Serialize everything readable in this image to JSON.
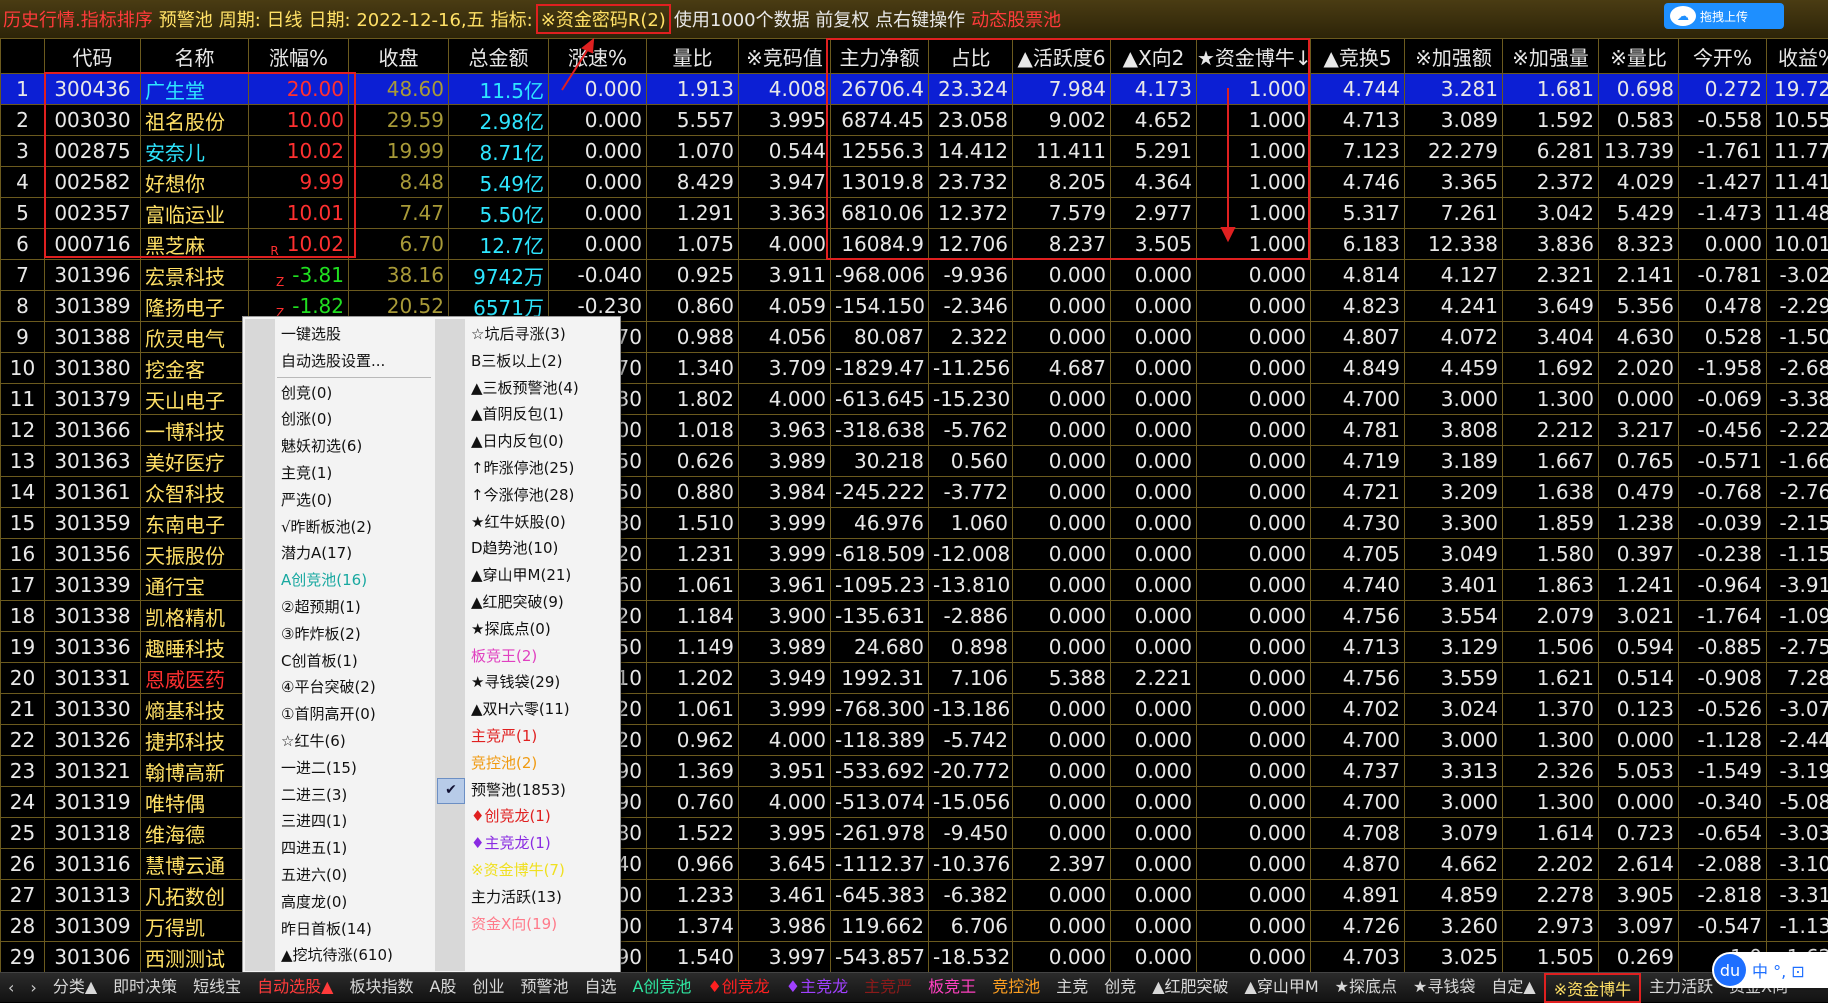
{
  "topbar": {
    "history": "历史行情.指标排序",
    "pool": "预警池",
    "period": "周期: 日线",
    "date": "日期: 2022-12-16,五",
    "indicator_label": "指标:",
    "indicator_value": "※资金密码R(2)",
    "info": "使用1000个数据 前复权 点右键操作",
    "dynamic": "动态股票池",
    "upload": "拖拽上传"
  },
  "columns": [
    "",
    "代码",
    "名称",
    "涨幅%",
    "收盘",
    "总金额",
    "涨速%",
    "量比",
    "※竞码值",
    "主力净额",
    "占比",
    "▲活跃度6",
    "▲X向2",
    "★资金博牛↓",
    "▲竞换5",
    "※加强额",
    "※加强量",
    "※量比",
    "今开%",
    "收益%"
  ],
  "rows": [
    {
      "i": "1",
      "code": "300436",
      "name": "广生堂",
      "chg": "20.00",
      "close": "48.60",
      "amt": "11.5亿",
      "spd": "0.000",
      "vr": "1.913",
      "jm": "4.008",
      "zl": "26706.4",
      "zb": "23.324",
      "hy": "7.984",
      "xx": "4.173",
      "bn": "1.000",
      "jh": "4.744",
      "qe": "3.281",
      "ql": "1.681",
      "lb": "0.698",
      "jk": "0.272",
      "sy": "19.728",
      "flag": ""
    },
    {
      "i": "2",
      "code": "003030",
      "name": "祖名股份",
      "chg": "10.00",
      "close": "29.59",
      "amt": "2.98亿",
      "spd": "0.000",
      "vr": "5.557",
      "jm": "3.995",
      "zl": "6874.45",
      "zb": "23.058",
      "hy": "9.002",
      "xx": "4.652",
      "bn": "1.000",
      "jh": "4.713",
      "qe": "3.089",
      "ql": "1.592",
      "lb": "0.583",
      "jk": "-0.558",
      "sy": "10.558",
      "flag": ""
    },
    {
      "i": "3",
      "code": "002875",
      "name": "安奈儿",
      "chg": "10.02",
      "close": "19.99",
      "amt": "8.71亿",
      "spd": "0.000",
      "vr": "1.070",
      "jm": "0.544",
      "zl": "12556.3",
      "zb": "14.412",
      "hy": "11.411",
      "xx": "5.291",
      "bn": "1.000",
      "jh": "7.123",
      "qe": "22.279",
      "ql": "6.281",
      "lb": "13.739",
      "jk": "-1.761",
      "sy": "11.778",
      "flag": ""
    },
    {
      "i": "4",
      "code": "002582",
      "name": "好想你",
      "chg": "9.99",
      "close": "8.48",
      "amt": "5.49亿",
      "spd": "0.000",
      "vr": "8.429",
      "jm": "3.947",
      "zl": "13019.8",
      "zb": "23.732",
      "hy": "8.205",
      "xx": "4.364",
      "bn": "1.000",
      "jh": "4.746",
      "qe": "3.365",
      "ql": "2.372",
      "lb": "4.029",
      "jk": "-1.427",
      "sy": "11.414",
      "flag": ""
    },
    {
      "i": "5",
      "code": "002357",
      "name": "富临运业",
      "chg": "10.01",
      "close": "7.47",
      "amt": "5.50亿",
      "spd": "0.000",
      "vr": "1.291",
      "jm": "3.363",
      "zl": "6810.06",
      "zb": "12.372",
      "hy": "7.579",
      "xx": "2.977",
      "bn": "1.000",
      "jh": "5.317",
      "qe": "7.261",
      "ql": "3.042",
      "lb": "5.429",
      "jk": "-1.473",
      "sy": "11.487",
      "flag": ""
    },
    {
      "i": "6",
      "code": "000716",
      "name": "黑芝麻",
      "chg": "10.02",
      "close": "6.70",
      "amt": "12.7亿",
      "spd": "0.000",
      "vr": "1.075",
      "jm": "4.000",
      "zl": "16084.9",
      "zb": "12.706",
      "hy": "8.237",
      "xx": "3.505",
      "bn": "1.000",
      "jh": "6.183",
      "qe": "12.338",
      "ql": "3.836",
      "lb": "8.323",
      "jk": "0.000",
      "sy": "10.016",
      "flag": "R"
    },
    {
      "i": "7",
      "code": "301396",
      "name": "宏景科技",
      "chg": "-3.81",
      "close": "38.16",
      "amt": "9742万",
      "spd": "-0.040",
      "vr": "0.925",
      "jm": "3.911",
      "zl": "-968.006",
      "zb": "-9.936",
      "hy": "0.000",
      "xx": "0.000",
      "bn": "0.000",
      "jh": "4.814",
      "qe": "4.127",
      "ql": "2.321",
      "lb": "2.141",
      "jk": "-0.781",
      "sy": "-3.025",
      "flag": "Z"
    },
    {
      "i": "8",
      "code": "301389",
      "name": "隆扬电子",
      "chg": "-1.82",
      "close": "20.52",
      "amt": "6571万",
      "spd": "-0.230",
      "vr": "0.860",
      "jm": "4.059",
      "zl": "-154.150",
      "zb": "-2.346",
      "hy": "0.000",
      "xx": "0.000",
      "bn": "0.000",
      "jh": "4.823",
      "qe": "4.241",
      "ql": "3.649",
      "lb": "5.356",
      "jk": "0.478",
      "sy": "-2.297",
      "flag": "Z"
    },
    {
      "i": "9",
      "code": "301388",
      "name": "欣灵电气",
      "chg": "",
      "close": "",
      "amt": "",
      "spd": "70",
      "vr": "0.988",
      "jm": "4.056",
      "zl": "80.087",
      "zb": "2.322",
      "hy": "0.000",
      "xx": "0.000",
      "bn": "0.000",
      "jh": "4.807",
      "qe": "4.072",
      "ql": "3.404",
      "lb": "4.630",
      "jk": "0.528",
      "sy": "-1.508",
      "flag": ""
    },
    {
      "i": "10",
      "code": "301380",
      "name": "挖金客",
      "chg": "",
      "close": "",
      "amt": "",
      "spd": "70",
      "vr": "1.340",
      "jm": "3.709",
      "zl": "-1829.47",
      "zb": "-11.256",
      "hy": "4.687",
      "xx": "0.000",
      "bn": "0.000",
      "jh": "4.849",
      "qe": "4.459",
      "ql": "1.692",
      "lb": "2.020",
      "jk": "-1.958",
      "sy": "-2.689",
      "flag": ""
    },
    {
      "i": "11",
      "code": "301379",
      "name": "天山电子",
      "chg": "",
      "close": "",
      "amt": "",
      "spd": "30",
      "vr": "1.802",
      "jm": "4.000",
      "zl": "-613.645",
      "zb": "-15.230",
      "hy": "0.000",
      "xx": "0.000",
      "bn": "0.000",
      "jh": "4.700",
      "qe": "3.000",
      "ql": "1.300",
      "lb": "0.000",
      "jk": "-0.069",
      "sy": "-3.389",
      "flag": ""
    },
    {
      "i": "12",
      "code": "301366",
      "name": "一博科技",
      "chg": "",
      "close": "",
      "amt": "",
      "spd": "00",
      "vr": "1.018",
      "jm": "3.963",
      "zl": "-318.638",
      "zb": "-5.762",
      "hy": "0.000",
      "xx": "0.000",
      "bn": "0.000",
      "jh": "4.781",
      "qe": "3.808",
      "ql": "2.212",
      "lb": "3.217",
      "jk": "-0.456",
      "sy": "-2.220",
      "flag": ""
    },
    {
      "i": "13",
      "code": "301363",
      "name": "美好医疗",
      "chg": "",
      "close": "",
      "amt": "",
      "spd": "50",
      "vr": "0.626",
      "jm": "3.989",
      "zl": "30.218",
      "zb": "0.560",
      "hy": "0.000",
      "xx": "0.000",
      "bn": "0.000",
      "jh": "4.719",
      "qe": "3.189",
      "ql": "1.667",
      "lb": "0.765",
      "jk": "-0.571",
      "sy": "-1.661",
      "flag": ""
    },
    {
      "i": "14",
      "code": "301361",
      "name": "众智科技",
      "chg": "",
      "close": "",
      "amt": "",
      "spd": "50",
      "vr": "0.880",
      "jm": "3.984",
      "zl": "-245.222",
      "zb": "-3.772",
      "hy": "0.000",
      "xx": "0.000",
      "bn": "0.000",
      "jh": "4.721",
      "qe": "3.209",
      "ql": "1.638",
      "lb": "0.479",
      "jk": "-0.768",
      "sy": "-2.765",
      "flag": ""
    },
    {
      "i": "15",
      "code": "301359",
      "name": "东南电子",
      "chg": "",
      "close": "",
      "amt": "",
      "spd": "80",
      "vr": "1.510",
      "jm": "3.999",
      "zl": "46.976",
      "zb": "1.060",
      "hy": "0.000",
      "xx": "0.000",
      "bn": "0.000",
      "jh": "4.730",
      "qe": "3.300",
      "ql": "1.859",
      "lb": "1.238",
      "jk": "-0.039",
      "sy": "-2.159",
      "flag": ""
    },
    {
      "i": "16",
      "code": "301356",
      "name": "天振股份",
      "chg": "",
      "close": "",
      "amt": "",
      "spd": "20",
      "vr": "1.231",
      "jm": "3.999",
      "zl": "-618.509",
      "zb": "-12.008",
      "hy": "0.000",
      "xx": "0.000",
      "bn": "0.000",
      "jh": "4.705",
      "qe": "3.049",
      "ql": "1.580",
      "lb": "0.397",
      "jk": "-0.238",
      "sy": "-1.151",
      "flag": ""
    },
    {
      "i": "17",
      "code": "301339",
      "name": "通行宝",
      "chg": "",
      "close": "",
      "amt": "",
      "spd": "60",
      "vr": "1.061",
      "jm": "3.961",
      "zl": "-1095.23",
      "zb": "-13.810",
      "hy": "0.000",
      "xx": "0.000",
      "bn": "0.000",
      "jh": "4.740",
      "qe": "3.401",
      "ql": "1.863",
      "lb": "1.241",
      "jk": "-0.964",
      "sy": "-3.914",
      "flag": ""
    },
    {
      "i": "18",
      "code": "301338",
      "name": "凯格精机",
      "chg": "",
      "close": "",
      "amt": "",
      "spd": "20",
      "vr": "1.184",
      "jm": "3.900",
      "zl": "-135.631",
      "zb": "-2.886",
      "hy": "0.000",
      "xx": "0.000",
      "bn": "0.000",
      "jh": "4.756",
      "qe": "3.554",
      "ql": "2.079",
      "lb": "3.021",
      "jk": "-1.764",
      "sy": "-1.091",
      "flag": ""
    },
    {
      "i": "19",
      "code": "301336",
      "name": "趣睡科技",
      "chg": "",
      "close": "",
      "amt": "",
      "spd": "50",
      "vr": "1.149",
      "jm": "3.989",
      "zl": "24.680",
      "zb": "0.898",
      "hy": "0.000",
      "xx": "0.000",
      "bn": "0.000",
      "jh": "4.713",
      "qe": "3.129",
      "ql": "1.506",
      "lb": "0.594",
      "jk": "-0.885",
      "sy": "-2.757",
      "flag": ""
    },
    {
      "i": "20",
      "code": "301331",
      "name": "恩威医药",
      "chg": "",
      "close": "",
      "amt": "",
      "spd": "10",
      "vr": "1.202",
      "jm": "3.949",
      "zl": "1992.31",
      "zb": "7.106",
      "hy": "5.388",
      "xx": "2.221",
      "bn": "0.000",
      "jh": "4.756",
      "qe": "3.559",
      "ql": "1.621",
      "lb": "0.514",
      "jk": "-0.908",
      "sy": "7.287",
      "flag": "",
      "red": true
    },
    {
      "i": "21",
      "code": "301330",
      "name": "熵基科技",
      "chg": "",
      "close": "",
      "amt": "",
      "spd": "20",
      "vr": "1.061",
      "jm": "3.999",
      "zl": "-768.300",
      "zb": "-13.186",
      "hy": "0.000",
      "xx": "0.000",
      "bn": "0.000",
      "jh": "4.702",
      "qe": "3.024",
      "ql": "1.370",
      "lb": "0.123",
      "jk": "-0.526",
      "sy": "-3.074",
      "flag": ""
    },
    {
      "i": "22",
      "code": "301326",
      "name": "捷邦科技",
      "chg": "",
      "close": "",
      "amt": "",
      "spd": "20",
      "vr": "0.962",
      "jm": "4.000",
      "zl": "-118.389",
      "zb": "-5.742",
      "hy": "0.000",
      "xx": "0.000",
      "bn": "0.000",
      "jh": "4.700",
      "qe": "3.000",
      "ql": "1.300",
      "lb": "0.000",
      "jk": "-1.128",
      "sy": "-2.447",
      "flag": ""
    },
    {
      "i": "23",
      "code": "301321",
      "name": "翰博高新",
      "chg": "",
      "close": "",
      "amt": "",
      "spd": "90",
      "vr": "1.369",
      "jm": "3.951",
      "zl": "-533.692",
      "zb": "-20.772",
      "hy": "0.000",
      "xx": "0.000",
      "bn": "0.000",
      "jh": "4.737",
      "qe": "3.313",
      "ql": "2.326",
      "lb": "5.053",
      "jk": "-1.549",
      "sy": "-3.192",
      "flag": ""
    },
    {
      "i": "24",
      "code": "301319",
      "name": "唯特偶",
      "chg": "",
      "close": "",
      "amt": "",
      "spd": "90",
      "vr": "0.760",
      "jm": "4.000",
      "zl": "-513.074",
      "zb": "-15.056",
      "hy": "0.000",
      "xx": "0.000",
      "bn": "0.000",
      "jh": "4.700",
      "qe": "3.000",
      "ql": "1.300",
      "lb": "0.000",
      "jk": "-0.340",
      "sy": "-5.085",
      "flag": ""
    },
    {
      "i": "25",
      "code": "301318",
      "name": "维海德",
      "chg": "",
      "close": "",
      "amt": "",
      "spd": "80",
      "vr": "1.522",
      "jm": "3.995",
      "zl": "-261.978",
      "zb": "-9.450",
      "hy": "0.000",
      "xx": "0.000",
      "bn": "0.000",
      "jh": "4.708",
      "qe": "3.079",
      "ql": "1.614",
      "lb": "0.723",
      "jk": "-0.654",
      "sy": "-3.030",
      "flag": ""
    },
    {
      "i": "26",
      "code": "301316",
      "name": "慧博云通",
      "chg": "",
      "close": "",
      "amt": "",
      "spd": "40",
      "vr": "0.966",
      "jm": "3.645",
      "zl": "-1112.37",
      "zb": "-10.376",
      "hy": "2.397",
      "xx": "0.000",
      "bn": "0.000",
      "jh": "4.870",
      "qe": "4.662",
      "ql": "2.202",
      "lb": "2.614",
      "jk": "-2.088",
      "sy": "-3.109",
      "flag": ""
    },
    {
      "i": "27",
      "code": "301313",
      "name": "凡拓数创",
      "chg": "",
      "close": "",
      "amt": "",
      "spd": "00",
      "vr": "1.233",
      "jm": "3.461",
      "zl": "-645.383",
      "zb": "-6.382",
      "hy": "0.000",
      "xx": "0.000",
      "bn": "0.000",
      "jh": "4.891",
      "qe": "4.859",
      "ql": "2.278",
      "lb": "3.905",
      "jk": "-2.818",
      "sy": "-3.316",
      "flag": ""
    },
    {
      "i": "28",
      "code": "301309",
      "name": "万得凯",
      "chg": "",
      "close": "",
      "amt": "",
      "spd": "00",
      "vr": "1.374",
      "jm": "3.986",
      "zl": "119.662",
      "zb": "6.706",
      "hy": "0.000",
      "xx": "0.000",
      "bn": "0.000",
      "jh": "4.726",
      "qe": "3.260",
      "ql": "2.973",
      "lb": "3.097",
      "jk": "-0.547",
      "sy": "-1.131",
      "flag": ""
    },
    {
      "i": "29",
      "code": "301306",
      "name": "西测测试",
      "chg": "",
      "close": "",
      "amt": "",
      "spd": "90",
      "vr": "1.540",
      "jm": "3.997",
      "zl": "-543.857",
      "zb": "-18.532",
      "hy": "0.000",
      "xx": "0.000",
      "bn": "0.000",
      "jh": "4.703",
      "qe": "3.025",
      "ql": "1.505",
      "lb": "0.269",
      "jk": "-1.0",
      "sy": "-1.622",
      "flag": ""
    }
  ],
  "menu": {
    "col1": [
      {
        "label": "一键选股",
        "sep_after": false
      },
      {
        "label": "自动选股设置...",
        "sep_after": true
      },
      {
        "label": "创竞(0)"
      },
      {
        "label": "创涨(0)"
      },
      {
        "label": "魅妖初选(6)"
      },
      {
        "label": "主竞(1)"
      },
      {
        "label": "严选(0)"
      },
      {
        "label": "√昨断板池(2)"
      },
      {
        "label": "潜力A(17)"
      },
      {
        "label": "A创竞池(16)",
        "color": "#18a8a0"
      },
      {
        "label": "②超预期(1)"
      },
      {
        "label": "③昨炸板(2)"
      },
      {
        "label": "C创首板(1)"
      },
      {
        "label": "④平台突破(2)"
      },
      {
        "label": "①首阴高开(0)"
      },
      {
        "label": "☆红牛(6)"
      },
      {
        "label": "一进二(15)"
      },
      {
        "label": "二进三(3)"
      },
      {
        "label": "三进四(1)"
      },
      {
        "label": "四进五(1)"
      },
      {
        "label": "五进六(0)"
      },
      {
        "label": "高度龙(0)"
      },
      {
        "label": "昨日首板(14)"
      },
      {
        "label": "▲挖坑待涨(610)"
      }
    ],
    "col2": [
      {
        "label": "☆坑后寻涨(3)"
      },
      {
        "label": "B三板以上(2)"
      },
      {
        "label": "▲三板预警池(4)"
      },
      {
        "label": "▲首阴反包(1)"
      },
      {
        "label": "▲日内反包(0)"
      },
      {
        "label": "↑昨涨停池(25)"
      },
      {
        "label": "↑今涨停池(28)"
      },
      {
        "label": "★红牛妖股(0)"
      },
      {
        "label": "D趋势池(10)"
      },
      {
        "label": "▲穿山甲M(21)"
      },
      {
        "label": "▲红肥突破(9)"
      },
      {
        "label": "★探底点(0)"
      },
      {
        "label": "板竞王(2)",
        "color": "#e040c0"
      },
      {
        "label": "★寻钱袋(29)"
      },
      {
        "label": "▲双H六零(11)"
      },
      {
        "label": "主竞严(1)",
        "color": "#e02020"
      },
      {
        "label": "竞控池(2)",
        "color": "#f09a10"
      },
      {
        "label": "预警池(1853)",
        "checked": true
      },
      {
        "label": "♦创竞龙(1)",
        "color": "#e02020"
      },
      {
        "label": "♦主竞龙(1)",
        "color": "#8a2be2"
      },
      {
        "label": "※资金博牛(7)",
        "color": "#f0e020"
      },
      {
        "label": "主力活跃(13)"
      },
      {
        "label": "资金X向(19)",
        "color": "#ff7a8a"
      }
    ]
  },
  "bottom": {
    "tabs": [
      {
        "label": "分类▲",
        "cls": ""
      },
      {
        "label": "即时决策",
        "cls": ""
      },
      {
        "label": "短线宝",
        "cls": ""
      },
      {
        "label": "自动选股▲",
        "cls": "active"
      },
      {
        "label": "板块指数",
        "cls": ""
      },
      {
        "label": "A股",
        "cls": ""
      },
      {
        "label": "创业",
        "cls": ""
      },
      {
        "label": "预警池",
        "cls": ""
      },
      {
        "label": "自选",
        "cls": ""
      },
      {
        "label": "A创竞池",
        "cls": "cy"
      },
      {
        "label": "♦创竞龙",
        "cls": "rd"
      },
      {
        "label": "♦主竞龙",
        "cls": "pu"
      },
      {
        "label": "主竞严",
        "cls": "dk"
      },
      {
        "label": "板竞王",
        "cls": "pk"
      },
      {
        "label": "竞控池",
        "cls": "or"
      },
      {
        "label": "主竞",
        "cls": ""
      },
      {
        "label": "创竞",
        "cls": ""
      },
      {
        "label": "▲红肥突破",
        "cls": ""
      },
      {
        "label": "▲穿山甲M",
        "cls": ""
      },
      {
        "label": "★探底点",
        "cls": ""
      },
      {
        "label": "★寻钱袋",
        "cls": ""
      },
      {
        "label": "自定▲",
        "cls": ""
      },
      {
        "label": "※资金博牛",
        "cls": "yl"
      },
      {
        "label": "主力活跃",
        "cls": ""
      },
      {
        "label": "资金X向",
        "cls": ""
      }
    ]
  },
  "ime": {
    "label": "中 °, ⊡"
  },
  "icons": {
    "nav_left": "‹",
    "nav_right": "›",
    "checkmark": "✔"
  },
  "colors": {
    "row_highlight": "#0c1fd4",
    "up": "#ff3030",
    "down": "#20e020",
    "annotation": "#e02020"
  }
}
